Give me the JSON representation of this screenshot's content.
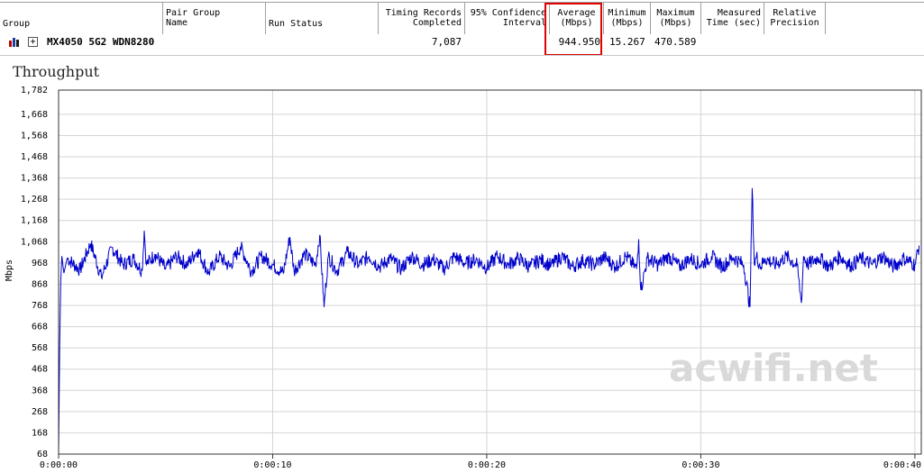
{
  "table": {
    "headers": [
      {
        "id": "group",
        "label": "Group"
      },
      {
        "id": "pair-group-name",
        "label": "Pair Group\nName"
      },
      {
        "id": "run-status",
        "label": "Run Status"
      },
      {
        "id": "timing-records",
        "label": "Timing Records\nCompleted"
      },
      {
        "id": "confidence",
        "label": "95% Confidence\nInterval"
      },
      {
        "id": "average",
        "label": "Average\n(Mbps)"
      },
      {
        "id": "minimum",
        "label": "Minimum\n(Mbps)"
      },
      {
        "id": "maximum",
        "label": "Maximum\n(Mbps)"
      },
      {
        "id": "measured-time",
        "label": "Measured\nTime (sec)"
      },
      {
        "id": "relative-precision",
        "label": "Relative\nPrecision"
      }
    ],
    "row": {
      "icon": "bar-chart-icon",
      "expand_icon": "plus-expand-icon",
      "expand_glyph": "+",
      "group": "MX4050 5G2 WDN8280",
      "timing_records": "7,087",
      "average": "944.950",
      "minimum": "15.267",
      "maximum": "470.589"
    },
    "highlight_color": "#e00000"
  },
  "chart_data": {
    "type": "line",
    "title": "Throughput",
    "ylabel": "Mbps",
    "xlabel": "",
    "y_ticks": [
      "1,782",
      "1,668",
      "1,568",
      "1,468",
      "1,368",
      "1,268",
      "1,168",
      "1,068",
      "968",
      "868",
      "768",
      "668",
      "568",
      "468",
      "368",
      "268",
      "168",
      "68"
    ],
    "x_ticks": [
      "0:00:00",
      "0:00:10",
      "0:00:20",
      "0:00:30",
      "0:00:40"
    ],
    "ylim": [
      68,
      1782
    ],
    "xlim": [
      0,
      40.3
    ],
    "grid": true,
    "line_color": "#0000cc",
    "series": [
      {
        "x": [
          0,
          0.05,
          0.1,
          0.15,
          0.25,
          0.4,
          1.0,
          1.5,
          2.0,
          2.5,
          3.0,
          3.5,
          3.9,
          4.0,
          4.1,
          4.5,
          5.0,
          5.5,
          6.0,
          6.5,
          7.0,
          7.5,
          8.0,
          8.5,
          9.0,
          9.5,
          10.0,
          10.5,
          10.8,
          11.0,
          11.5,
          12.0,
          12.2,
          12.4,
          12.6,
          13.0,
          13.5,
          14.0,
          14.5,
          15.0,
          15.5,
          16.0,
          16.5,
          17.0,
          17.5,
          18.0,
          18.5,
          19.0,
          19.5,
          20.0,
          20.5,
          21.0,
          21.5,
          22.0,
          22.5,
          23.0,
          23.5,
          24.0,
          24.5,
          25.0,
          25.5,
          26.0,
          26.5,
          27.0,
          27.1,
          27.2,
          27.5,
          28.0,
          28.5,
          29.0,
          29.5,
          30.0,
          30.5,
          31.0,
          31.5,
          32.0,
          32.3,
          32.4,
          32.5,
          32.6,
          32.8,
          33.0,
          33.5,
          34.0,
          34.5,
          34.7,
          34.8,
          35.0,
          35.5,
          36.0,
          36.5,
          37.0,
          37.5,
          38.0,
          38.5,
          39.0,
          39.5,
          40.0,
          40.2
        ],
        "y": [
          70,
          580,
          880,
          1000,
          920,
          990,
          935,
          1060,
          900,
          1040,
          960,
          990,
          930,
          1120,
          960,
          1010,
          940,
          1000,
          960,
          1030,
          920,
          1000,
          950,
          1045,
          930,
          1000,
          960,
          920,
          1090,
          930,
          1010,
          960,
          1100,
          760,
          1000,
          930,
          1020,
          960,
          1000,
          950,
          990,
          940,
          1000,
          960,
          985,
          940,
          1000,
          965,
          985,
          945,
          1000,
          960,
          990,
          950,
          985,
          955,
          1000,
          950,
          980,
          960,
          995,
          950,
          1000,
          940,
          1080,
          840,
          990,
          960,
          1000,
          950,
          990,
          960,
          1000,
          950,
          995,
          960,
          760,
          1320,
          960,
          1000,
          950,
          990,
          960,
          1000,
          955,
          780,
          1000,
          960,
          995,
          950,
          1000,
          955,
          990,
          960,
          1000,
          950,
          990,
          960,
          1050
        ]
      }
    ]
  },
  "watermark": "acwifi.net"
}
